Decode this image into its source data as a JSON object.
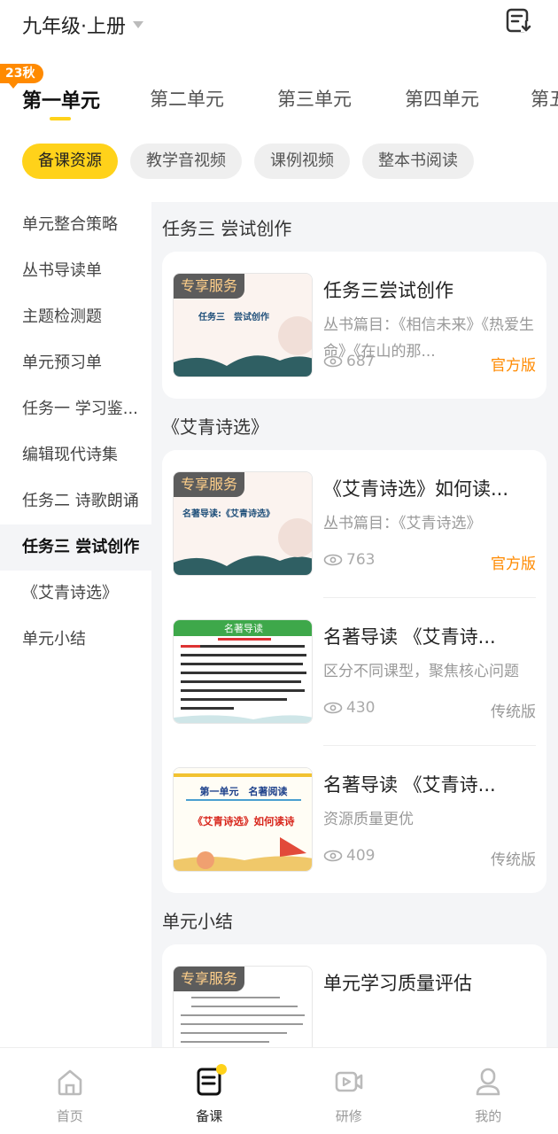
{
  "header": {
    "grade_label": "九年级·上册",
    "icon": "list-download-icon"
  },
  "units": {
    "badge": "23秋",
    "tabs": [
      "第一单元",
      "第二单元",
      "第三单元",
      "第四单元",
      "第五"
    ],
    "active_index": 0
  },
  "chips": [
    "备课资源",
    "教学音视频",
    "课例视频",
    "整本书阅读"
  ],
  "sidebar": {
    "items": [
      "单元整合策略",
      "丛书导读单",
      "主题检测题",
      "单元预习单",
      "任务一 学习鉴...",
      "编辑现代诗集",
      "任务二 诗歌朗诵",
      "任务三 尝试创作",
      "《艾青诗选》",
      "单元小结"
    ],
    "active_index": 7
  },
  "sections": [
    {
      "title": "任务三 尝试创作",
      "items": [
        {
          "badge": "专享服务",
          "thumb_text": "任务三　尝试创作",
          "title": "任务三尝试创作",
          "desc": "丛书篇目：《相信未来》《热爱生命》《在山的那...",
          "views": "687",
          "version": "官方版"
        }
      ]
    },
    {
      "title": "《艾青诗选》",
      "items": [
        {
          "badge": "专享服务",
          "thumb_text": "名著导读:《艾青诗选》",
          "title": "《艾青诗选》如何读...",
          "desc": "丛书篇目：《艾青诗选》",
          "views": "763",
          "version": "官方版"
        },
        {
          "thumb_header": "名著导读",
          "title": "名著导读 《艾青诗...",
          "desc": "区分不同课型，聚焦核心问题",
          "views": "430",
          "version": "传统版"
        },
        {
          "thumb_line1": "第一单元　名著阅读",
          "thumb_line2": "《艾青诗选》如何读诗",
          "title": "名著导读 《艾青诗...",
          "desc": "资源质量更优",
          "views": "409",
          "version": "传统版"
        }
      ]
    },
    {
      "title": "单元小结",
      "items": [
        {
          "badge": "专享服务",
          "title": "单元学习质量评估"
        }
      ]
    }
  ],
  "bottom_nav": {
    "items": [
      {
        "label": "首页",
        "icon": "home-icon"
      },
      {
        "label": "备课",
        "icon": "lesson-prep-icon"
      },
      {
        "label": "研修",
        "icon": "video-training-icon"
      },
      {
        "label": "我的",
        "icon": "profile-icon"
      }
    ],
    "active_index": 1
  },
  "colors": {
    "accent": "#ffd21a",
    "official": "#ff8a00",
    "background": "#f4f5f7"
  }
}
